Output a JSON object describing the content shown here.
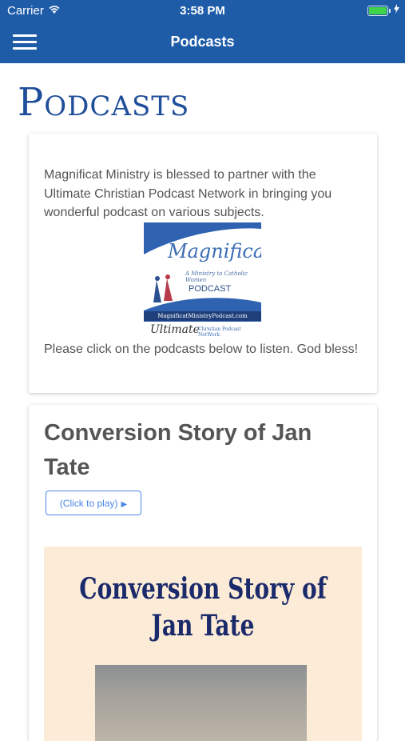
{
  "status_bar": {
    "carrier": "Carrier",
    "time": "3:58 PM"
  },
  "nav": {
    "title": "Podcasts"
  },
  "page": {
    "heading": "Podcasts"
  },
  "intro_card": {
    "text": "Magnificat Ministry is blessed to partner with the Ultimate Christian Podcast Network in bringing you wonderful podcast on various subjects.",
    "footer": "Please click on the podcasts below to listen. God bless!",
    "logo": {
      "script": "Magnificat",
      "subtitle": "A Ministry to Catholic Women",
      "label": "PODCAST",
      "url": "MagnificatMinistryPodcast.com",
      "ultimate": "Ultimate",
      "network": "Christian Podcast NetWork"
    }
  },
  "episodes": [
    {
      "title": "Conversion Story of Jan Tate",
      "play_label": "(Click to play)",
      "cover_title_line1": "Conversion Story of",
      "cover_title_line2": "Jan Tate"
    }
  ],
  "colors": {
    "header": "#1f5ca8",
    "heading": "#1f4e9a",
    "accent": "#4a86e8",
    "cover_bg": "#fcebd6"
  },
  "icons": {
    "menu": "hamburger-icon",
    "wifi": "wifi-icon",
    "battery": "battery-icon",
    "play": "play-triangle-icon"
  }
}
